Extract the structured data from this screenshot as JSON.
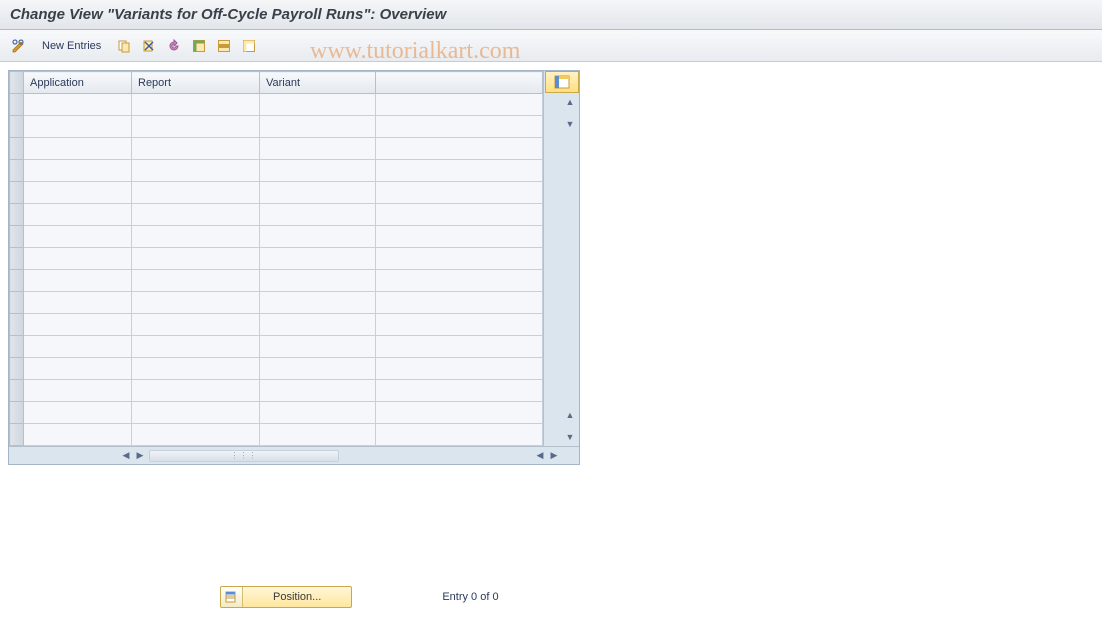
{
  "title": "Change View \"Variants for Off-Cycle Payroll Runs\": Overview",
  "toolbar": {
    "new_entries_label": "New Entries"
  },
  "table": {
    "columns": {
      "application": "Application",
      "report": "Report",
      "variant": "Variant"
    },
    "rows": [
      {
        "application": "",
        "report": "",
        "variant": ""
      },
      {
        "application": "",
        "report": "",
        "variant": ""
      },
      {
        "application": "",
        "report": "",
        "variant": ""
      },
      {
        "application": "",
        "report": "",
        "variant": ""
      },
      {
        "application": "",
        "report": "",
        "variant": ""
      },
      {
        "application": "",
        "report": "",
        "variant": ""
      },
      {
        "application": "",
        "report": "",
        "variant": ""
      },
      {
        "application": "",
        "report": "",
        "variant": ""
      },
      {
        "application": "",
        "report": "",
        "variant": ""
      },
      {
        "application": "",
        "report": "",
        "variant": ""
      },
      {
        "application": "",
        "report": "",
        "variant": ""
      },
      {
        "application": "",
        "report": "",
        "variant": ""
      },
      {
        "application": "",
        "report": "",
        "variant": ""
      },
      {
        "application": "",
        "report": "",
        "variant": ""
      },
      {
        "application": "",
        "report": "",
        "variant": ""
      },
      {
        "application": "",
        "report": "",
        "variant": ""
      }
    ]
  },
  "footer": {
    "position_label": "Position...",
    "entry_text": "Entry 0 of 0"
  },
  "watermark": "www.tutorialkart.com"
}
